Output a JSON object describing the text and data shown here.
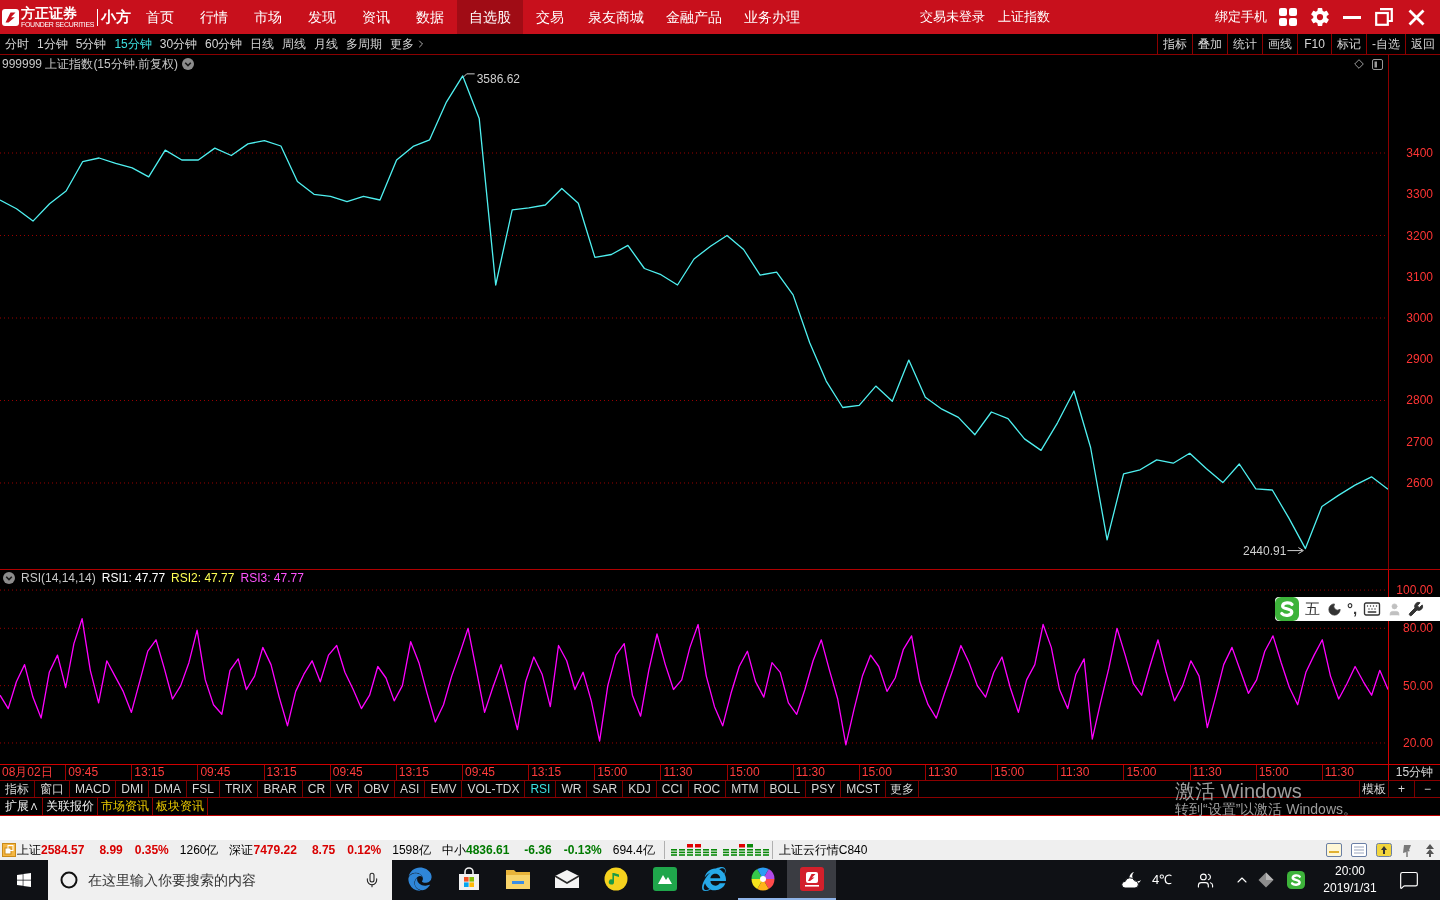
{
  "title_bar": {
    "logo": {
      "name": "方正证券",
      "subtitle": "FOUNDER SECURITIES",
      "product": "小方"
    },
    "menu": [
      {
        "label": "首页",
        "selected": false
      },
      {
        "label": "行情",
        "selected": false
      },
      {
        "label": "市场",
        "selected": false
      },
      {
        "label": "发现",
        "selected": false
      },
      {
        "label": "资讯",
        "selected": false
      },
      {
        "label": "数据",
        "selected": false
      },
      {
        "label": "自选股",
        "selected": true
      },
      {
        "label": "交易",
        "selected": false
      },
      {
        "label": "泉友商城",
        "selected": false
      },
      {
        "label": "金融产品",
        "selected": false
      },
      {
        "label": "业务办理",
        "selected": false
      }
    ],
    "info": [
      "交易未登录",
      "上证指数"
    ],
    "bind_phone": "绑定手机"
  },
  "period_bar": {
    "periods": [
      {
        "label": "分时",
        "selected": false
      },
      {
        "label": "1分钟",
        "selected": false
      },
      {
        "label": "5分钟",
        "selected": false
      },
      {
        "label": "15分钟",
        "selected": true
      },
      {
        "label": "30分钟",
        "selected": false
      },
      {
        "label": "60分钟",
        "selected": false
      },
      {
        "label": "日线",
        "selected": false
      },
      {
        "label": "周线",
        "selected": false
      },
      {
        "label": "月线",
        "selected": false
      },
      {
        "label": "多周期",
        "selected": false
      }
    ],
    "more": "更多",
    "tools": [
      "指标",
      "叠加",
      "统计",
      "画线",
      "F10",
      "标记",
      "-自选",
      "返回"
    ]
  },
  "price_panel": {
    "title": "999999 上证指数(15分钟.前复权)",
    "chart_data": {
      "type": "line",
      "series": [
        {
          "color": "#4ff0f0",
          "values": [
            3286,
            3265,
            3235,
            3277,
            3308,
            3379,
            3388,
            3375,
            3364,
            3342,
            3407,
            3383,
            3383,
            3412,
            3394,
            3422,
            3430,
            3417,
            3331,
            3300,
            3295,
            3282,
            3295,
            3286,
            3383,
            3416,
            3432,
            3522,
            3587,
            3484,
            3080,
            3262,
            3267,
            3274,
            3314,
            3278,
            3147,
            3154,
            3176,
            3120,
            3105,
            3080,
            3143,
            3174,
            3200,
            3166,
            3104,
            3111,
            3056,
            2940,
            2847,
            2783,
            2788,
            2835,
            2798,
            2898,
            2808,
            2779,
            2759,
            2717,
            2772,
            2756,
            2707,
            2679,
            2746,
            2823,
            2686,
            2462,
            2622,
            2632,
            2656,
            2648,
            2672,
            2635,
            2601,
            2646,
            2586,
            2583,
            2515,
            2441,
            2543,
            2570,
            2595,
            2615,
            2585
          ]
        }
      ],
      "ylim": [
        2391.5,
        3637.6
      ],
      "yticks": [
        {
          "value": 2600,
          "label": "2600"
        },
        {
          "value": 2700,
          "label": "2700"
        },
        {
          "value": 2800,
          "label": "2800"
        },
        {
          "value": 2900,
          "label": "2900"
        },
        {
          "value": 3000,
          "label": "3000"
        },
        {
          "value": 3100,
          "label": "3100"
        },
        {
          "value": 3200,
          "label": "3200"
        },
        {
          "value": 3300,
          "label": "3300"
        },
        {
          "value": 3400,
          "label": "3400"
        }
      ],
      "grid": true,
      "annotations": [
        "3586.62",
        "2440.91"
      ]
    }
  },
  "rsi_panel": {
    "legend": [
      {
        "text": "RSI(14,14,14)",
        "color": "#c8c8c8"
      },
      {
        "text": "RSI1: 47.77",
        "color": "#ffffff"
      },
      {
        "text": "RSI2: 47.77",
        "color": "#ffff54"
      },
      {
        "text": "RSI3: 47.77",
        "color": "#ff54ff"
      }
    ],
    "chart_data": {
      "type": "line",
      "series": [
        {
          "color": "#ff00ff",
          "values": [
            45,
            38,
            52,
            61,
            44,
            33,
            57,
            66,
            49,
            72,
            85,
            58,
            41,
            63,
            55,
            47,
            36,
            52,
            68,
            74,
            59,
            43,
            50,
            62,
            79,
            53,
            40,
            35,
            58,
            64,
            48,
            55,
            70,
            61,
            44,
            29,
            47,
            56,
            63,
            52,
            66,
            71,
            57,
            48,
            38,
            45,
            60,
            54,
            42,
            50,
            73,
            62,
            46,
            31,
            40,
            55,
            67,
            80,
            58,
            36,
            49,
            61,
            44,
            27,
            52,
            65,
            56,
            39,
            71,
            63,
            48,
            57,
            42,
            21,
            50,
            66,
            72,
            45,
            34,
            58,
            77,
            61,
            48,
            53,
            70,
            82,
            55,
            39,
            29,
            46,
            60,
            68,
            52,
            44,
            62,
            57,
            41,
            35,
            48,
            63,
            74,
            58,
            43,
            19,
            38,
            55,
            66,
            60,
            47,
            54,
            69,
            76,
            52,
            40,
            33,
            46,
            58,
            71,
            62,
            50,
            44,
            57,
            65,
            49,
            36,
            53,
            61,
            82,
            70,
            48,
            38,
            56,
            64,
            22,
            41,
            59,
            80,
            66,
            51,
            45,
            60,
            74,
            57,
            42,
            50,
            63,
            55,
            28,
            44,
            61,
            70,
            58,
            46,
            53,
            68,
            76,
            62,
            49,
            40,
            57,
            66,
            74,
            55,
            43,
            51,
            60,
            52,
            45,
            58,
            48
          ]
        }
      ],
      "ylim": [
        9.0,
        110.5
      ],
      "yticks": [
        {
          "value": 20,
          "label": "20.00"
        },
        {
          "value": 50,
          "label": "50.00"
        },
        {
          "value": 80,
          "label": "80.00"
        },
        {
          "value": 100,
          "label": "100.00"
        }
      ],
      "grid": true
    }
  },
  "time_axis": {
    "labels": [
      "08月02日",
      "09:45",
      "13:15",
      "09:45",
      "13:15",
      "09:45",
      "13:15",
      "09:45",
      "13:15",
      "15:00",
      "11:30",
      "15:00",
      "11:30",
      "15:00",
      "11:30",
      "15:00",
      "11:30",
      "15:00",
      "11:30",
      "15:00",
      "11:30"
    ],
    "period": "15分钟"
  },
  "indicator_bar": {
    "tabs": [
      {
        "label": "指标",
        "selected": false
      },
      {
        "label": "窗口",
        "selected": false
      },
      {
        "label": "MACD",
        "selected": false
      },
      {
        "label": "DMI",
        "selected": false
      },
      {
        "label": "DMA",
        "selected": false
      },
      {
        "label": "FSL",
        "selected": false
      },
      {
        "label": "TRIX",
        "selected": false
      },
      {
        "label": "BRAR",
        "selected": false
      },
      {
        "label": "CR",
        "selected": false
      },
      {
        "label": "VR",
        "selected": false
      },
      {
        "label": "OBV",
        "selected": false
      },
      {
        "label": "ASI",
        "selected": false
      },
      {
        "label": "EMV",
        "selected": false
      },
      {
        "label": "VOL-TDX",
        "selected": false
      },
      {
        "label": "RSI",
        "selected": true
      },
      {
        "label": "WR",
        "selected": false
      },
      {
        "label": "SAR",
        "selected": false
      },
      {
        "label": "KDJ",
        "selected": false
      },
      {
        "label": "CCI",
        "selected": false
      },
      {
        "label": "ROC",
        "selected": false
      },
      {
        "label": "MTM",
        "selected": false
      },
      {
        "label": "BOLL",
        "selected": false
      },
      {
        "label": "PSY",
        "selected": false
      },
      {
        "label": "MCST",
        "selected": false
      }
    ],
    "more": "更多",
    "template": "模板",
    "zoom_in": "+",
    "zoom_out": "−"
  },
  "extension_bar": {
    "tabs": [
      {
        "label": "扩展∧",
        "kind": "panel"
      },
      {
        "label": "关联报价",
        "kind": "panel"
      },
      {
        "label": "市场资讯",
        "kind": "news"
      },
      {
        "label": "板块资讯",
        "kind": "news"
      }
    ]
  },
  "status_bar": {
    "indices": [
      {
        "name": "上证",
        "price": "2584.57",
        "change": "8.99",
        "percent": "0.35%",
        "turnover": "1260亿",
        "color": "#d80000"
      },
      {
        "name": "深证",
        "price": "7479.22",
        "change": "8.75",
        "percent": "0.12%",
        "turnover": "1598亿",
        "color": "#d80000"
      },
      {
        "name": "中小",
        "price": "4836.61",
        "change": "-6.36",
        "percent": "-0.13%",
        "turnover": "694.4亿",
        "color": "#007a00"
      }
    ],
    "feed": "上证云行情C840"
  },
  "ime_toolbar": {
    "mode": "五",
    "punctuation": "°,"
  },
  "activation_notice": {
    "title": "激活 Windows",
    "message": "转到“设置”以激活 Windows。"
  },
  "taskbar": {
    "search": {
      "placeholder": "在这里输入你要搜索的内容"
    },
    "apps": [
      {
        "kind": "browser",
        "running": false,
        "selected": false
      },
      {
        "kind": "store",
        "running": false,
        "selected": false
      },
      {
        "kind": "folder",
        "running": false,
        "selected": false
      },
      {
        "kind": "mail",
        "running": false,
        "selected": false
      },
      {
        "kind": "music",
        "running": false,
        "selected": false
      },
      {
        "kind": "tiles",
        "running": false,
        "selected": false
      },
      {
        "kind": "browser_ring",
        "running": false,
        "selected": false
      },
      {
        "kind": "pinwheel",
        "running": true,
        "selected": false
      },
      {
        "kind": "broker",
        "running": true,
        "selected": true
      }
    ],
    "weather": "4℃",
    "time": "20:00",
    "date": "2019/1/31"
  }
}
